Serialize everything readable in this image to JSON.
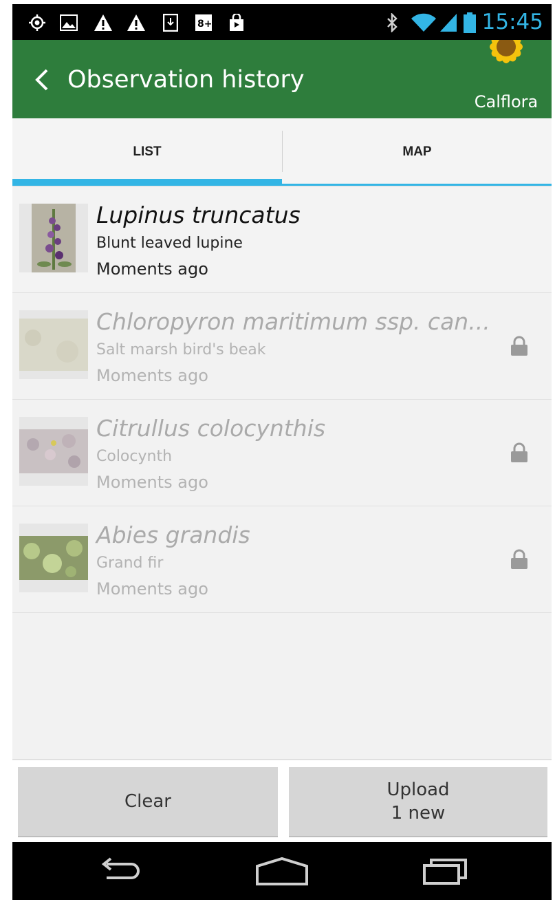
{
  "status_bar": {
    "time": "15:45",
    "left_icons": [
      "location-icon",
      "image-icon",
      "warning-icon",
      "warning-icon",
      "download-icon",
      "google-plus-icon",
      "shopping-bag-icon"
    ],
    "right_icons": [
      "bluetooth-icon",
      "wifi-icon",
      "signal-icon",
      "battery-icon"
    ]
  },
  "action_bar": {
    "title": "Observation history",
    "logo_text": "Calflora",
    "color": "#2e7d3c"
  },
  "tabs": [
    {
      "label": "LIST",
      "selected": true
    },
    {
      "label": "MAP",
      "selected": false
    }
  ],
  "accent_color": "#33b5e5",
  "observations": [
    {
      "scientific_name": "Lupinus truncatus",
      "common_name": "Blunt leaved lupine",
      "time": "Moments ago",
      "locked": false
    },
    {
      "scientific_name": "Chloropyron maritimum ssp. can...",
      "common_name": "Salt marsh bird's beak",
      "time": "Moments ago",
      "locked": true
    },
    {
      "scientific_name": "Citrullus colocynthis",
      "common_name": "Colocynth",
      "time": "Moments ago",
      "locked": true
    },
    {
      "scientific_name": "Abies grandis",
      "common_name": "Grand fir",
      "time": "Moments ago",
      "locked": true
    }
  ],
  "buttons": {
    "clear": "Clear",
    "upload_line1": "Upload",
    "upload_line2": "1 new"
  },
  "nav_bar": [
    "back-icon",
    "home-icon",
    "recents-icon"
  ]
}
